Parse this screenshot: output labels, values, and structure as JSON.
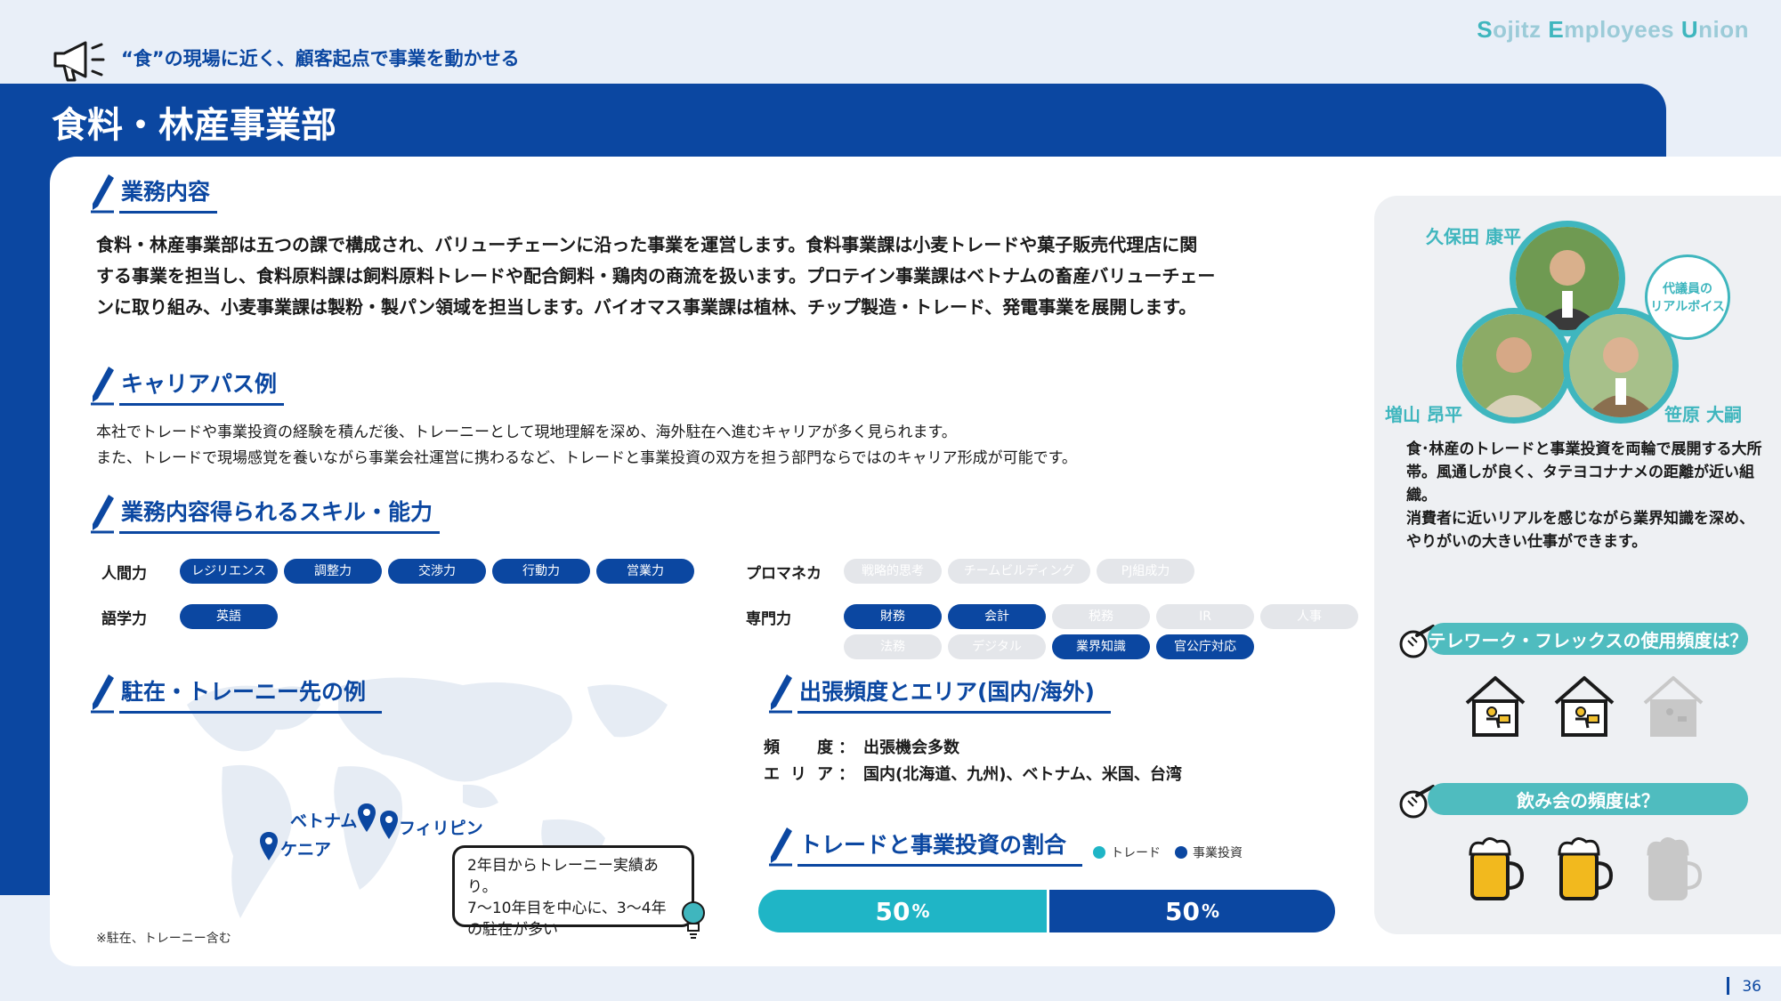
{
  "header": {
    "brand": {
      "s": "S",
      "ojitz": "ojitz ",
      "e": "E",
      "mployees": "mployees ",
      "u": "U",
      "nion": "nion"
    },
    "tagline": "“食”の現場に近く、顧客起点で事業を動かせる",
    "title": "食料・林産事業部"
  },
  "sections": {
    "business": {
      "heading": "業務内容",
      "lines": [
        "食料・林産事業部は五つの課で構成され、バリューチェーンに沿った事業を運営します。食料事業課は小麦トレードや菓子販売代理店に関",
        "する事業を担当し、食料原料課は飼料原料トレードや配合飼料・鶏肉の商流を扱います。プロテイン事業課はベトナムの畜産バリューチェー",
        "ンに取り組み、小麦事業課は製粉・製パン領域を担当します。バイオマス事業課は植林、チップ製造・トレード、発電事業を展開します。"
      ]
    },
    "career": {
      "heading": "キャリアパス例",
      "lines": [
        "本社でトレードや事業投資の経験を積んだ後、トレーニーとして現地理解を深め、海外駐在へ進むキャリアが多く見られます。",
        "また、トレードで現場感覚を養いながら事業会社運営に携わるなど、トレードと事業投資の双方を担う部門ならではのキャリア形成が可能です。"
      ]
    },
    "skills": {
      "heading": "業務内容得られるスキル・能力",
      "groups": [
        {
          "name": "人間力",
          "items": [
            {
              "label": "レジリエンス",
              "active": true
            },
            {
              "label": "調整力",
              "active": true
            },
            {
              "label": "交渉力",
              "active": true
            },
            {
              "label": "行動力",
              "active": true
            },
            {
              "label": "営業力",
              "active": true
            }
          ]
        },
        {
          "name": "語学力",
          "items": [
            {
              "label": "英語",
              "active": true
            }
          ]
        },
        {
          "name": "プロマネカ",
          "items": [
            {
              "label": "戦略的思考",
              "active": false
            },
            {
              "label": "チームビルディング",
              "active": false
            },
            {
              "label": "PJ組成力",
              "active": false
            }
          ]
        },
        {
          "name": "専門力",
          "items": [
            {
              "label": "財務",
              "active": true
            },
            {
              "label": "会計",
              "active": true
            },
            {
              "label": "税務",
              "active": false
            },
            {
              "label": "IR",
              "active": false
            },
            {
              "label": "人事",
              "active": false
            },
            {
              "label": "法務",
              "active": false
            },
            {
              "label": "デジタル",
              "active": false
            },
            {
              "label": "業界知識",
              "active": true
            },
            {
              "label": "官公庁対応",
              "active": true
            }
          ]
        }
      ]
    },
    "trainee": {
      "heading": "駐在・トレーニー先の例",
      "pins": [
        "ベトナム",
        "フィリピン",
        "ケニア"
      ],
      "callout": [
        "2年目からトレーニー実績あり。",
        "7～10年目を中心に、3～4年",
        "の駐在が多い"
      ],
      "note": "※駐在、トレーニー含む"
    },
    "trip": {
      "heading": "出張頻度とエリア(国内/海外)",
      "freq_key": "頻　度",
      "freq_value": "出張機会多数",
      "area_key": "エリア",
      "area_value": "国内(北海道、九州)、ベトナム、米国、台湾",
      "sep": "："
    },
    "ratio": {
      "heading": "トレードと事業投資の割合",
      "legend": [
        {
          "label": "トレード",
          "color": "#1fb5c6"
        },
        {
          "label": "事業投資",
          "color": "#0b47a1"
        }
      ],
      "trade_pct": 50,
      "invest_pct": 50,
      "trade_text": "50",
      "invest_text": "50",
      "unit": "%"
    }
  },
  "voice": {
    "names": [
      "久保田 康平",
      "増山 昂平",
      "笹原 大嗣"
    ],
    "bubble": [
      "代議員の",
      "リアルボイス"
    ],
    "text": [
      "食･林産のトレードと事業投資を両輪で展開する大所",
      "帯。風通しが良く、タテヨコナナメの距離が近い組織。",
      "消費者に近いリアルを感じながら業界知識を深め、",
      "やりがいの大きい仕事ができます。"
    ],
    "q1": {
      "question": "テレワーク・フレックスの使用頻度は？",
      "level": 2,
      "max": 3
    },
    "q2": {
      "question": "飲み会の頻度は？",
      "level": 2,
      "max": 3
    }
  },
  "page_number": "36",
  "colors": {
    "primary": "#0b47a1",
    "teal": "#3fb6be",
    "trade": "#1fb5c6"
  }
}
